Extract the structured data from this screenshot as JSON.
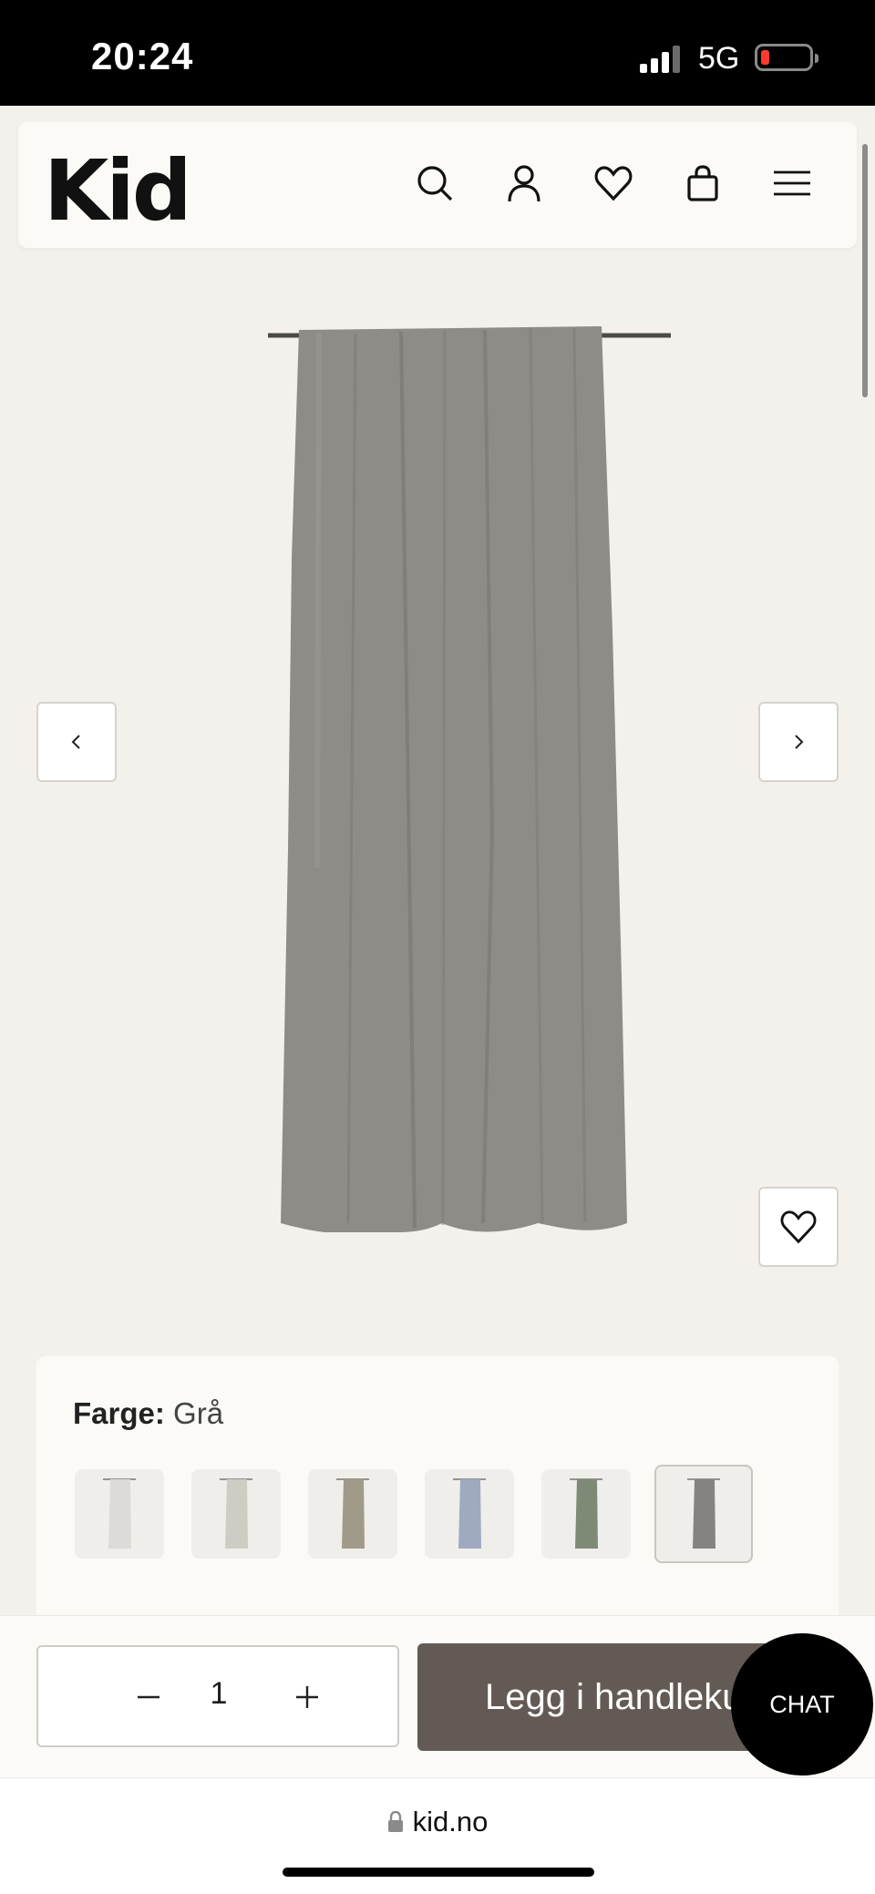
{
  "status_bar": {
    "time": "20:24",
    "network": "5G",
    "battery_color": "#ff3b30"
  },
  "header": {
    "logo": "Kid",
    "icons": [
      "search-icon",
      "account-icon",
      "wishlist-icon",
      "cart-icon",
      "menu-icon"
    ]
  },
  "gallery": {
    "prev_icon": "chevron-left-icon",
    "next_icon": "chevron-right-icon",
    "favorite_icon": "heart-icon",
    "product_color": "#8f8c88"
  },
  "color_selector": {
    "label": "Farge:",
    "value": "Grå",
    "swatches": [
      {
        "color": "#dcdbd8",
        "selected": false
      },
      {
        "color": "#cfccc3",
        "selected": false
      },
      {
        "color": "#a09a88",
        "selected": false
      },
      {
        "color": "#9fa9c0",
        "selected": false
      },
      {
        "color": "#7e8a76",
        "selected": false
      },
      {
        "color": "#858280",
        "selected": true
      }
    ]
  },
  "purchase": {
    "quantity": "1",
    "add_to_cart_label": "Legg i handlekurv",
    "button_color": "#635a55"
  },
  "chat": {
    "label": "CHAT"
  },
  "browser": {
    "url": "kid.no"
  }
}
